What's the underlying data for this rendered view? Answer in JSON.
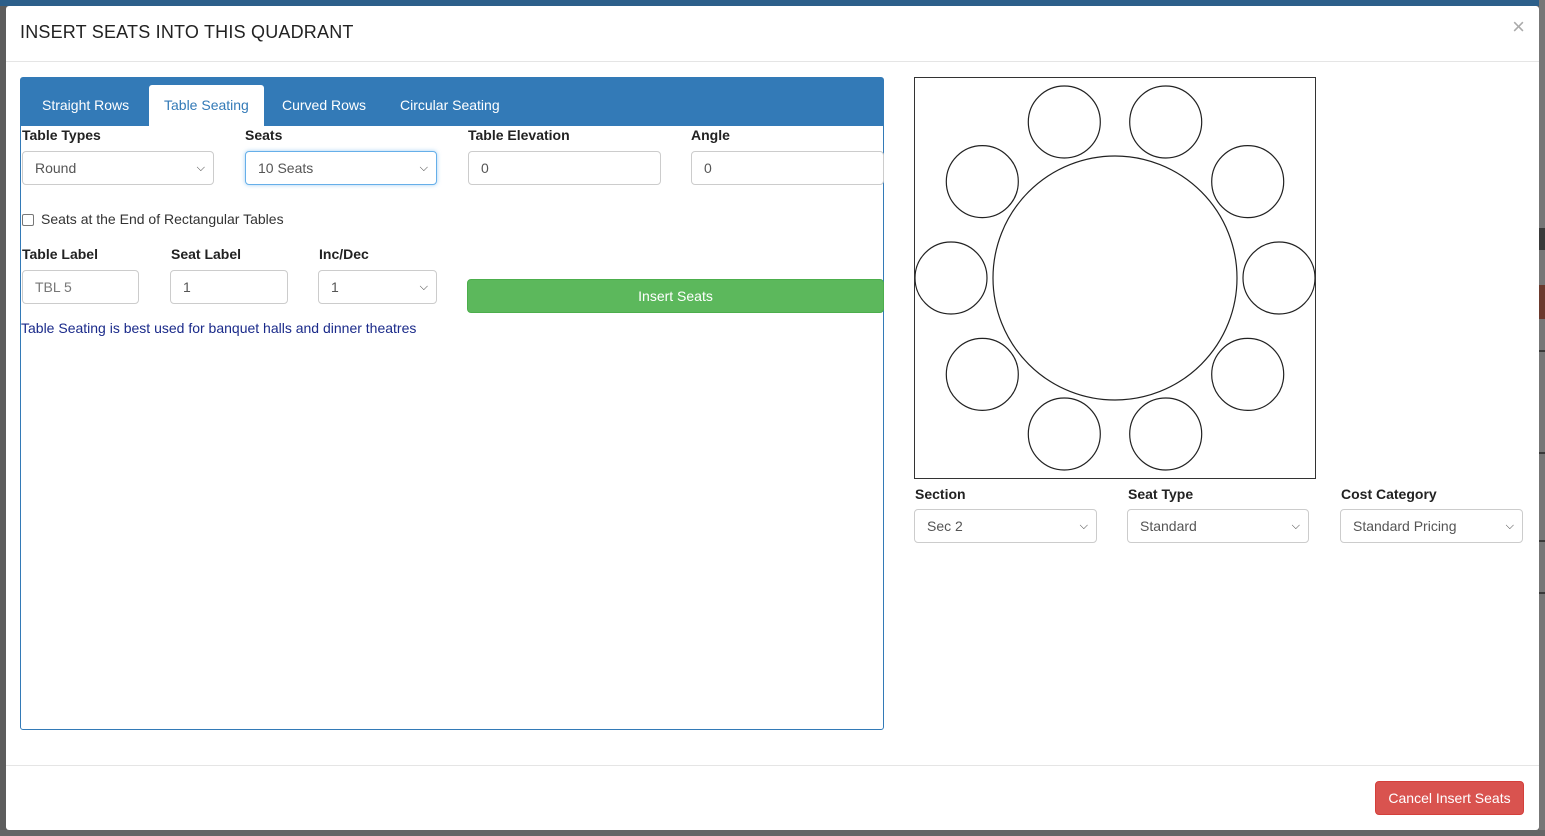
{
  "modal": {
    "title": "INSERT SEATS INTO THIS QUADRANT",
    "close_glyph": "×",
    "cancel_label": "Cancel Insert Seats"
  },
  "tabs": [
    {
      "label": "Straight Rows",
      "active": false
    },
    {
      "label": "Table Seating",
      "active": true
    },
    {
      "label": "Curved Rows",
      "active": false
    },
    {
      "label": "Circular Seating",
      "active": false
    }
  ],
  "form": {
    "table_types": {
      "label": "Table Types",
      "value": "Round"
    },
    "seats": {
      "label": "Seats",
      "value": "10 Seats"
    },
    "table_elevation": {
      "label": "Table Elevation",
      "value": "0"
    },
    "angle": {
      "label": "Angle",
      "value": "0"
    },
    "end_seats": {
      "label": "Seats at the End of Rectangular Tables",
      "checked": false
    },
    "table_label": {
      "label": "Table Label",
      "placeholder": "TBL 5"
    },
    "seat_label": {
      "label": "Seat Label",
      "value": "1"
    },
    "inc_dec": {
      "label": "Inc/Dec",
      "value": "1"
    },
    "insert_label": "Insert Seats",
    "help_text": "Table Seating is best used for banquet halls and dinner theatres"
  },
  "preview": {
    "table_shape": "round",
    "seat_count": 10
  },
  "assign": {
    "section": {
      "label": "Section",
      "value": "Sec 2"
    },
    "seat_type": {
      "label": "Seat Type",
      "value": "Standard"
    },
    "cost_category": {
      "label": "Cost Category",
      "value": "Standard Pricing"
    }
  },
  "colors": {
    "primary": "#337ab7",
    "success": "#5cb85c",
    "danger": "#d9534f",
    "help_text": "#1a2a8a"
  },
  "icons": {
    "dropdown": "chevron-down-icon",
    "close": "close-icon"
  }
}
